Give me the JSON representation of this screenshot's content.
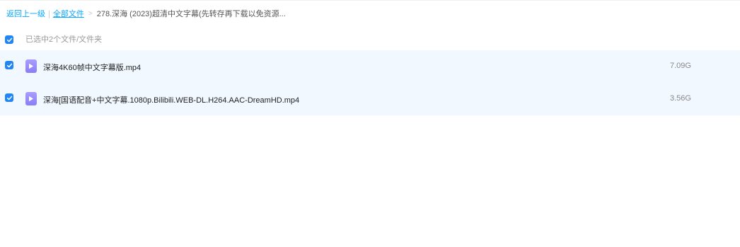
{
  "breadcrumb": {
    "back_label": "返回上一级",
    "separator": "|",
    "all_files_label": "全部文件",
    "arrow": ">",
    "current_folder": "278.深海 (2023)超清中文字幕(先转存再下载以免资源..."
  },
  "selection": {
    "summary": "已选中2个文件/文件夹",
    "checked": true
  },
  "files": [
    {
      "name": "深海4K60帧中文字幕版.mp4",
      "size": "7.09G",
      "type": "video",
      "checked": true
    },
    {
      "name": "深海[国语配音+中文字幕.1080p.Bilibili.WEB-DL.H264.AAC-DreamHD.mp4",
      "size": "3.56G",
      "type": "video",
      "checked": true
    }
  ],
  "colors": {
    "accent": "#06a7ff",
    "checkbox": "#2185f4",
    "row_selected_bg": "#f1f8ff",
    "video_icon": "#8b7df6"
  },
  "icons": {
    "checkbox": "check-icon",
    "file_type": "video-play-icon"
  }
}
